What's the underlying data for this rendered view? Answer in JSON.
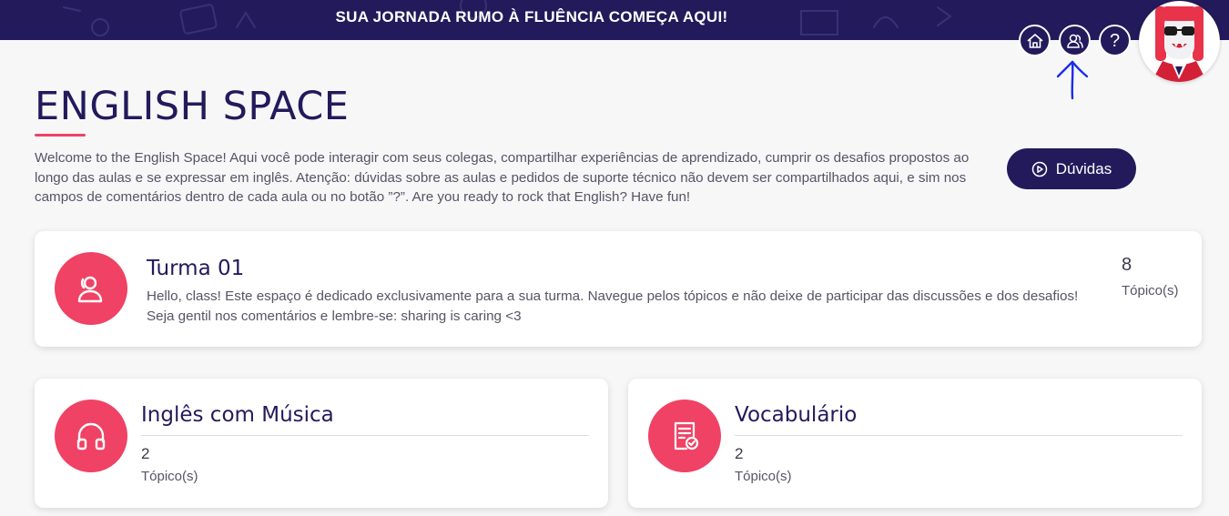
{
  "banner": {
    "text": "SUA JORNADA RUMO À FLUÊNCIA COMEÇA AQUI!"
  },
  "header_icons": [
    {
      "icon": "home-icon"
    },
    {
      "icon": "user-group-icon"
    },
    {
      "icon": "help-icon",
      "glyph": "?"
    }
  ],
  "page": {
    "title": "ENGLISH SPACE",
    "intro": "Welcome to the English Space! Aqui você pode interagir com seus colegas, compartilhar experiências de aprendizado, cumprir os desafios propostos ao longo das aulas e se expressar em inglês. Atenção: dúvidas sobre as aulas e pedidos de suporte técnico não devem ser compartilhados aqui, e sim nos campos de comentários dentro de cada aula ou no botão ”?”. Are you ready to rock that English? Have fun!",
    "duvidas_label": "Dúvidas"
  },
  "turma": {
    "title": "Turma 01",
    "description": "Hello, class! Este espaço é dedicado exclusivamente para a sua turma. Navegue pelos tópicos e não deixe de participar das discussões e dos desafios! Seja gentil nos comentários e lembre-se: sharing is caring <3",
    "count": "8",
    "count_label": "Tópico(s)"
  },
  "spaces": [
    {
      "title": "Inglês com Música",
      "count": "2",
      "count_label": "Tópico(s)",
      "icon": "headphones-icon"
    },
    {
      "title": "Vocabulário",
      "count": "2",
      "count_label": "Tópico(s)",
      "icon": "document-check-icon"
    }
  ],
  "colors": {
    "navy": "#231a5c",
    "accent": "#ef4264",
    "background": "#f7f7f8",
    "annotation": "#1a2ee8"
  }
}
